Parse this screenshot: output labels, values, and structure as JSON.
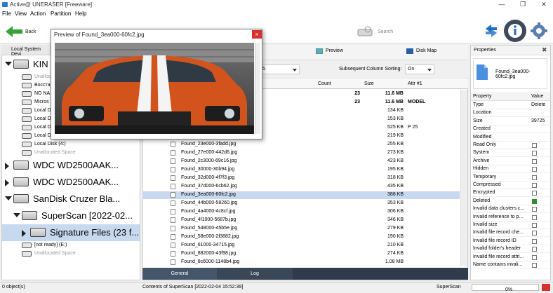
{
  "window": {
    "title": "Active@ UNERASER [Freeware]"
  },
  "menu": [
    "File",
    "View",
    "Action",
    "Partition",
    "Help"
  ],
  "toolbar": {
    "back": "Back",
    "search": "Search"
  },
  "left_panel": {
    "tab": "Local System Devi",
    "items": [
      {
        "label": "KIN",
        "size": "big",
        "indent": 0,
        "expanded": true
      },
      {
        "label": "Unalloc",
        "size": "small",
        "indent": 1,
        "dim": true
      },
      {
        "label": "Восста",
        "size": "small",
        "indent": 1
      },
      {
        "label": "NO NA",
        "size": "small",
        "indent": 1
      },
      {
        "label": "Micros",
        "size": "small",
        "indent": 1
      },
      {
        "label": "Local D",
        "size": "small",
        "indent": 1
      },
      {
        "label": "Local D",
        "size": "small",
        "indent": 1
      },
      {
        "label": "Local D",
        "size": "small",
        "indent": 1
      },
      {
        "label": "Local Disk (3:)",
        "size": "small",
        "indent": 1
      },
      {
        "label": "Local Disk (4:)",
        "size": "small",
        "indent": 1
      },
      {
        "label": "Unallocated Space",
        "size": "small",
        "indent": 1,
        "dim": true
      },
      {
        "label": "WDC WD2500AAK...",
        "size": "big",
        "indent": 0
      },
      {
        "label": "WDC WD2500AAK...",
        "size": "big",
        "indent": 0
      },
      {
        "label": "SanDisk Cruzer Bla...",
        "size": "big",
        "indent": 0,
        "expanded": true
      },
      {
        "label": "SuperScan [2022-02...",
        "size": "big",
        "indent": 1,
        "expanded": true
      },
      {
        "label": "Signature Files (23 f...",
        "size": "big",
        "indent": 2,
        "selected": true
      },
      {
        "label": "[not ready] (E:)",
        "size": "small",
        "indent": 1
      },
      {
        "label": "Unallocated Space",
        "size": "small",
        "indent": 1,
        "dim": true
      }
    ]
  },
  "center": {
    "preview_btn": "Preview",
    "diskmap_btn": "Disk Map",
    "sort_first_value": "5",
    "subsequent_label": "Subsequent Column Sorting:",
    "subsequent_value": "On",
    "columns": [
      "Count",
      "Size",
      "Attr #1"
    ],
    "rows": [
      {
        "name": "",
        "count": "23",
        "size": "11.6 MB",
        "attr": "",
        "bold": true
      },
      {
        "name": "",
        "count": "23",
        "size": "11.6 MB",
        "attr": "MODEL",
        "bold": true
      },
      {
        "name": "",
        "count": "",
        "size": "134 KB",
        "attr": ""
      },
      {
        "name": "",
        "count": "",
        "size": "153 KB",
        "attr": ""
      },
      {
        "name": "",
        "count": "",
        "size": "525 KB",
        "attr": "P 25"
      },
      {
        "name": "",
        "count": "",
        "size": "219 KB",
        "attr": ""
      },
      {
        "name": "Found_23e000-3fadd.jpg",
        "count": "",
        "size": "255 KB",
        "attr": ""
      },
      {
        "name": "Found_27e000-442d6.jpg",
        "count": "",
        "size": "273 KB",
        "attr": ""
      },
      {
        "name": "Found_2c3000-69c16.jpg",
        "count": "",
        "size": "423 KB",
        "attr": ""
      },
      {
        "name": "Found_30000-30b94.jpg",
        "count": "",
        "size": "195 KB",
        "attr": ""
      },
      {
        "name": "Found_32d000-4f7f3.jpg",
        "count": "",
        "size": "318 KB",
        "attr": ""
      },
      {
        "name": "Found_37d000-6cb62.jpg",
        "count": "",
        "size": "435 KB",
        "attr": ""
      },
      {
        "name": "Found_3ea000-60fc2.jpg",
        "count": "",
        "size": "388 KB",
        "attr": "",
        "selected": true
      },
      {
        "name": "Found_44b000-58260.jpg",
        "count": "",
        "size": "353 KB",
        "attr": ""
      },
      {
        "name": "Found_4a4000-4c8cf.jpg",
        "count": "",
        "size": "306 KB",
        "attr": ""
      },
      {
        "name": "Found_4f1000-5687b.jpg",
        "count": "",
        "size": "346 KB",
        "attr": ""
      },
      {
        "name": "Found_548000-45b5e.jpg",
        "count": "",
        "size": "279 KB",
        "attr": ""
      },
      {
        "name": "Found_58e000-2f3882.jpg",
        "count": "",
        "size": "190 KB",
        "attr": ""
      },
      {
        "name": "Found_61000-34715.jpg",
        "count": "",
        "size": "210 KB",
        "attr": ""
      },
      {
        "name": "Found_882000-43f98.jpg",
        "count": "",
        "size": "274 KB",
        "attr": ""
      },
      {
        "name": "Found_8c6000-1148b4.jpg",
        "count": "",
        "size": "1.08 MB",
        "attr": ""
      }
    ],
    "tabs": [
      "General",
      "Log"
    ]
  },
  "preview": {
    "title": "Preview of Found_3ea000-60fc2.jpg",
    "close": "×"
  },
  "properties": {
    "title": "Properties",
    "file": "Found_3ea000-60fc2.jpg",
    "col_property": "Property",
    "col_value": "Value",
    "rows": [
      {
        "name": "Type",
        "value": "Delete"
      },
      {
        "name": "Location",
        "value": ""
      },
      {
        "name": "Size",
        "value": "39725"
      },
      {
        "name": "Created",
        "value": ""
      },
      {
        "name": "Modified",
        "value": ""
      },
      {
        "name": "Read Only",
        "check": false
      },
      {
        "name": "System",
        "check": false
      },
      {
        "name": "Archive",
        "check": false
      },
      {
        "name": "Hidden",
        "check": false
      },
      {
        "name": "Temporary",
        "check": false
      },
      {
        "name": "Compressed",
        "check": false
      },
      {
        "name": "Encrypted",
        "check": false
      },
      {
        "name": "Deleted",
        "check": true
      },
      {
        "name": "Invalid data clusters c...",
        "check": false
      },
      {
        "name": "Invalid reference to p...",
        "check": false
      },
      {
        "name": "Invalid size",
        "check": false
      },
      {
        "name": "Invalid file record che...",
        "check": false
      },
      {
        "name": "Invalid file record ID",
        "check": false
      },
      {
        "name": "Invalid folder's header",
        "check": false
      },
      {
        "name": "Invalid file record attri...",
        "check": false
      },
      {
        "name": "Name contains invali...",
        "check": false
      }
    ]
  },
  "status": {
    "left": "0 object(s)",
    "center": "Contents of SuperScan [2022-02-04 15:52:39]",
    "right_label": "SuperScan",
    "progress": "0%"
  }
}
